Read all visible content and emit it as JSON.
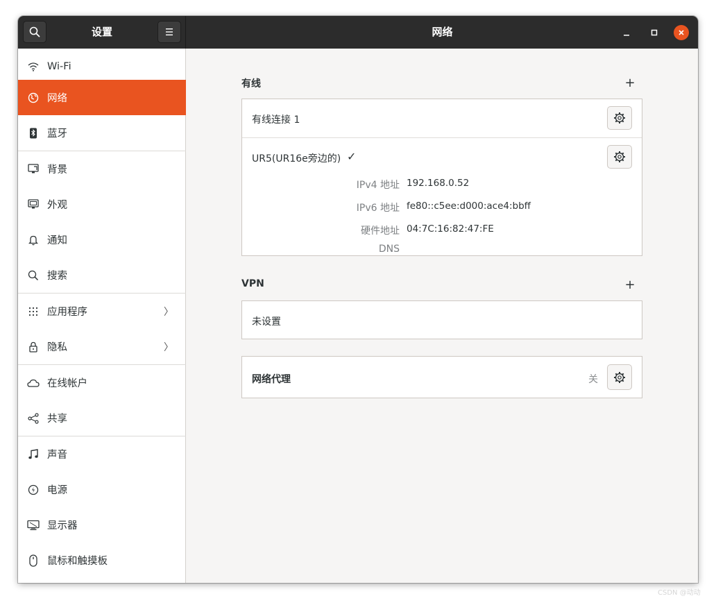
{
  "header": {
    "left_title": "设置",
    "main_title": "网络",
    "search_icon": "search-icon",
    "menu_icon": "hamburger-menu-icon",
    "window_controls": [
      "minimize-icon",
      "maximize-icon",
      "close-icon"
    ]
  },
  "sidebar": {
    "items": [
      {
        "label": "Wi-Fi",
        "icon": "wifi-icon"
      },
      {
        "label": "网络",
        "icon": "network-globe-icon",
        "active": true
      },
      {
        "label": "蓝牙",
        "icon": "bluetooth-icon"
      },
      {
        "label": "背景",
        "icon": "background-icon"
      },
      {
        "label": "外观",
        "icon": "appearance-icon"
      },
      {
        "label": "通知",
        "icon": "bell-icon"
      },
      {
        "label": "搜索",
        "icon": "search-icon"
      },
      {
        "label": "应用程序",
        "icon": "apps-grid-icon",
        "chevron": "〉"
      },
      {
        "label": "隐私",
        "icon": "lock-icon",
        "chevron": "〉"
      },
      {
        "label": "在线帐户",
        "icon": "cloud-icon"
      },
      {
        "label": "共享",
        "icon": "share-icon"
      },
      {
        "label": "声音",
        "icon": "music-note-icon"
      },
      {
        "label": "电源",
        "icon": "power-icon"
      },
      {
        "label": "显示器",
        "icon": "display-icon"
      },
      {
        "label": "鼠标和触摸板",
        "icon": "mouse-icon"
      }
    ]
  },
  "wired": {
    "title": "有线",
    "add_label": "+",
    "connection_name": "有线连接 1",
    "active_name": "UR5(UR16e旁边的)",
    "active_check": "✓",
    "details": [
      {
        "key": "IPv4 地址",
        "value": "192.168.0.52"
      },
      {
        "key": "IPv6 地址",
        "value": "fe80::c5ee:d000:ace4:bbff"
      },
      {
        "key": "硬件地址",
        "value": "04:7C:16:82:47:FE"
      },
      {
        "key": "DNS",
        "value": ""
      }
    ]
  },
  "vpn": {
    "title": "VPN",
    "add_label": "+",
    "status": "未设置"
  },
  "proxy": {
    "title": "网络代理",
    "state": "关"
  },
  "colors": {
    "accent": "#e95420",
    "headerbar": "#2c2c2c",
    "window_bg": "#f6f5f4"
  },
  "watermark": "CSDN @动动"
}
